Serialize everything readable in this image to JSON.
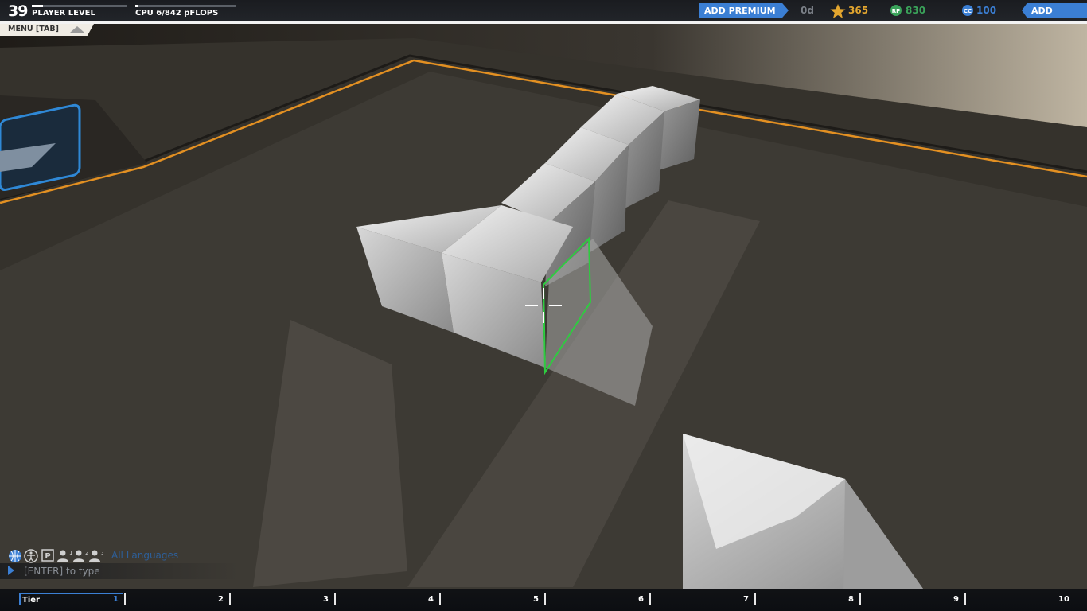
{
  "player": {
    "level": "39",
    "level_label": "PLAYER LEVEL",
    "cpu_label": "CPU 6/842 pFLOPS"
  },
  "menu": {
    "label": "MENU [TAB]"
  },
  "topbar": {
    "add_premium": "ADD PREMIUM",
    "premium_time": "0d",
    "currencies": [
      {
        "icon": "star-icon",
        "value": "365",
        "color": "#e3a62f"
      },
      {
        "icon": "robit-points-icon",
        "value": "830",
        "color": "#3aa35a"
      },
      {
        "icon": "cosmetic-credits-icon",
        "value": "100",
        "color": "#3b7fd4"
      }
    ],
    "add_funds": "ADD FUNDS"
  },
  "chat": {
    "language": "All Languages",
    "input_placeholder": "[ENTER] to type",
    "channel_icons": [
      "globe-icon",
      "accessibility-icon",
      "p-icon",
      "party-1-icon",
      "party-2-icon",
      "party-3-icon"
    ]
  },
  "tiers": {
    "label": "Tier",
    "numbers": [
      "1",
      "2",
      "3",
      "4",
      "5",
      "6",
      "7",
      "8",
      "9",
      "10"
    ]
  }
}
